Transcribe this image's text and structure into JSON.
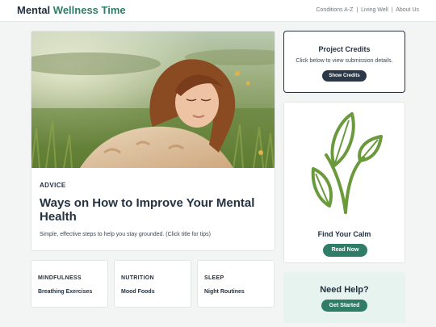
{
  "header": {
    "brand_primary": "Mental",
    "brand_accent": "Wellness Time",
    "nav": [
      "Conditions A-Z",
      "Living Well",
      "About Us"
    ],
    "nav_separator": "|"
  },
  "hero": {
    "image_alt": "Woman relaxing in a grassy field",
    "eyebrow": "ADVICE",
    "title": "Ways on How to Improve Your Mental Health",
    "subtitle": "Simple, effective steps to help you stay grounded. (Click title for tips)"
  },
  "credits": {
    "title": "Project Credits",
    "text": "Click below to view submission details.",
    "button": "Show Credits"
  },
  "calm": {
    "title": "Find Your Calm",
    "button": "Read Now",
    "icon": "plant-icon"
  },
  "categories": [
    {
      "label": "MINDFULNESS",
      "link": "Breathing Exercises"
    },
    {
      "label": "NUTRITION",
      "link": "Mood Foods"
    },
    {
      "label": "SLEEP",
      "link": "Night Routines"
    }
  ],
  "help": {
    "title": "Need Help?",
    "button": "Get Started"
  },
  "colors": {
    "accent": "#2f7d66",
    "dark": "#243242",
    "help_bg": "#e7f3ef",
    "page_bg": "#f3f5f4"
  }
}
